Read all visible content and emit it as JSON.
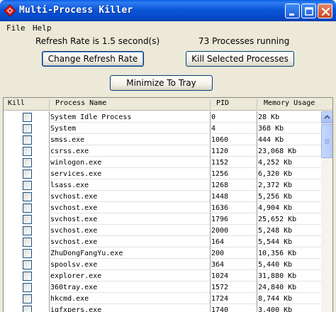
{
  "window": {
    "title": "Multi-Process Killer"
  },
  "menu": {
    "file": "File",
    "help": "Help"
  },
  "status": {
    "refresh_rate": "Refresh Rate is 1.5 second(s)",
    "process_count": "73 Processes running"
  },
  "buttons": {
    "change_refresh": "Change Refresh Rate",
    "kill_selected": "Kill Selected Processes",
    "minimize_tray": "Minimize To Tray"
  },
  "table": {
    "columns": {
      "kill": "Kill",
      "name": "Process Name",
      "pid": "PID",
      "memory": "Memory Usage"
    },
    "rows": [
      {
        "name": "System Idle Process",
        "pid": "0",
        "memory": "28 Kb"
      },
      {
        "name": "System",
        "pid": "4",
        "memory": "368 Kb"
      },
      {
        "name": "smss.exe",
        "pid": "1060",
        "memory": "444 Kb"
      },
      {
        "name": "csrss.exe",
        "pid": "1120",
        "memory": "23,068 Kb"
      },
      {
        "name": "winlogon.exe",
        "pid": "1152",
        "memory": "4,252 Kb"
      },
      {
        "name": "services.exe",
        "pid": "1256",
        "memory": "6,320 Kb"
      },
      {
        "name": "lsass.exe",
        "pid": "1268",
        "memory": "2,372 Kb"
      },
      {
        "name": "svchost.exe",
        "pid": "1448",
        "memory": "5,256 Kb"
      },
      {
        "name": "svchost.exe",
        "pid": "1636",
        "memory": "4,904 Kb"
      },
      {
        "name": "svchost.exe",
        "pid": "1796",
        "memory": "25,652 Kb"
      },
      {
        "name": "svchost.exe",
        "pid": "2000",
        "memory": "5,248 Kb"
      },
      {
        "name": "svchost.exe",
        "pid": "164",
        "memory": "5,544 Kb"
      },
      {
        "name": "ZhuDongFangYu.exe",
        "pid": "200",
        "memory": "10,356 Kb"
      },
      {
        "name": "spoolsv.exe",
        "pid": "364",
        "memory": "5,440 Kb"
      },
      {
        "name": "explorer.exe",
        "pid": "1024",
        "memory": "31,880 Kb"
      },
      {
        "name": "360tray.exe",
        "pid": "1572",
        "memory": "24,840 Kb"
      },
      {
        "name": "hkcmd.exe",
        "pid": "1724",
        "memory": "8,744 Kb"
      },
      {
        "name": "igfxpers.exe",
        "pid": "1740",
        "memory": "3,400 Kb"
      }
    ]
  },
  "colors": {
    "titlebar": "#0A56D8",
    "window_bg": "#ECE9D8",
    "button_border": "#003C74"
  }
}
